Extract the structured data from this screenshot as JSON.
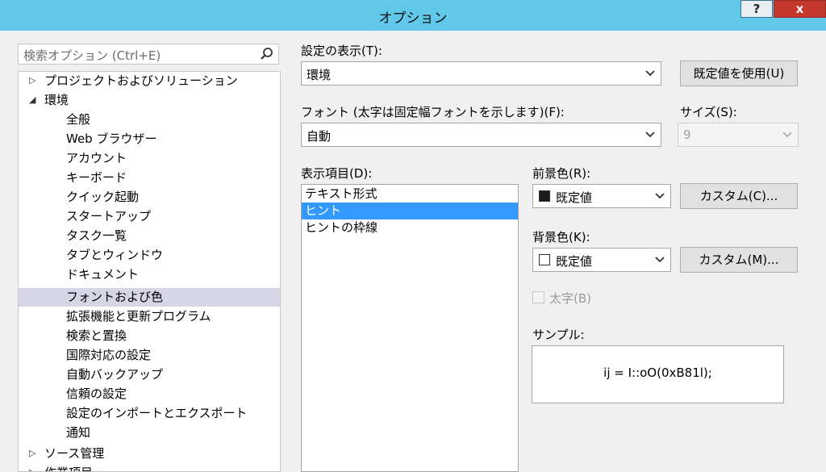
{
  "window": {
    "title": "オプション",
    "help_label": "?",
    "close_label": "x"
  },
  "search": {
    "placeholder": "検索オプション (Ctrl+E)"
  },
  "tree": {
    "items": [
      {
        "label": "プロジェクトおよびソリューション",
        "expander": "collapsed"
      },
      {
        "label": "環境",
        "expander": "expanded"
      },
      {
        "label": "全般"
      },
      {
        "label": "Web ブラウザー"
      },
      {
        "label": "アカウント"
      },
      {
        "label": "キーボード"
      },
      {
        "label": "クイック起動"
      },
      {
        "label": "スタートアップ"
      },
      {
        "label": "タスク一覧"
      },
      {
        "label": "タブとウィンドウ"
      },
      {
        "label": "ドキュメント"
      },
      {
        "label": "フォントおよび色",
        "selected": true
      },
      {
        "label": "拡張機能と更新プログラム"
      },
      {
        "label": "検索と置換"
      },
      {
        "label": "国際対応の設定"
      },
      {
        "label": "自動バックアップ"
      },
      {
        "label": "信頼の設定"
      },
      {
        "label": "設定のインポートとエクスポート"
      },
      {
        "label": "通知"
      },
      {
        "label": "ソース管理",
        "expander": "collapsed"
      },
      {
        "label": "作業項目",
        "expander": "collapsed"
      }
    ]
  },
  "show_settings": {
    "label": "設定の表示(T):",
    "value": "環境",
    "default_button": "既定値を使用(U)"
  },
  "font": {
    "label": "フォント (太字は固定幅フォントを示します)(F):",
    "value": "自動"
  },
  "size": {
    "label": "サイズ(S):",
    "value": "9"
  },
  "display_items": {
    "label": "表示項目(D):",
    "items": [
      {
        "label": "テキスト形式"
      },
      {
        "label": "ヒント",
        "selected": true
      },
      {
        "label": "ヒントの枠線"
      }
    ]
  },
  "foreground": {
    "label": "前景色(R):",
    "value": "既定値",
    "swatch_color": "#1a1a1a",
    "custom_button": "カスタム(C)..."
  },
  "background": {
    "label": "背景色(K):",
    "value": "既定値",
    "swatch_color": "#ffffff",
    "custom_button": "カスタム(M)..."
  },
  "bold": {
    "label": "太字(B)",
    "checked": false
  },
  "sample": {
    "label": "サンプル:",
    "text": "ij = I::oO(0xB81l);"
  },
  "colors": {
    "titlebar": "#62c8ea",
    "close": "#c4372c",
    "list_selection": "#3399ff",
    "tree_selection": "#d6d6e6"
  }
}
